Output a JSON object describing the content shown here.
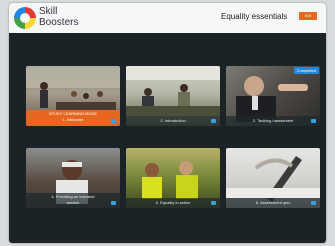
{
  "header": {
    "logo_line1": "Skill",
    "logo_line2": "Boosters",
    "title": "Equality essentials",
    "exit_label": "Exit"
  },
  "modules": [
    {
      "label_line1": "STUDY LEARNING MODE",
      "label_line2": "1. Welcome",
      "active": true
    },
    {
      "label_line1": "2. Introduction"
    },
    {
      "label_line1": "3. Tackling harassment",
      "badge": "Completed"
    },
    {
      "label_line1": "4. Providing an inclusive",
      "label_line2": "service"
    },
    {
      "label_line1": "5. Equality in action"
    },
    {
      "label_line1": "6. Assessment quiz"
    }
  ],
  "colors": {
    "accent": "#e8661f",
    "tick": "#3aa0e0"
  }
}
